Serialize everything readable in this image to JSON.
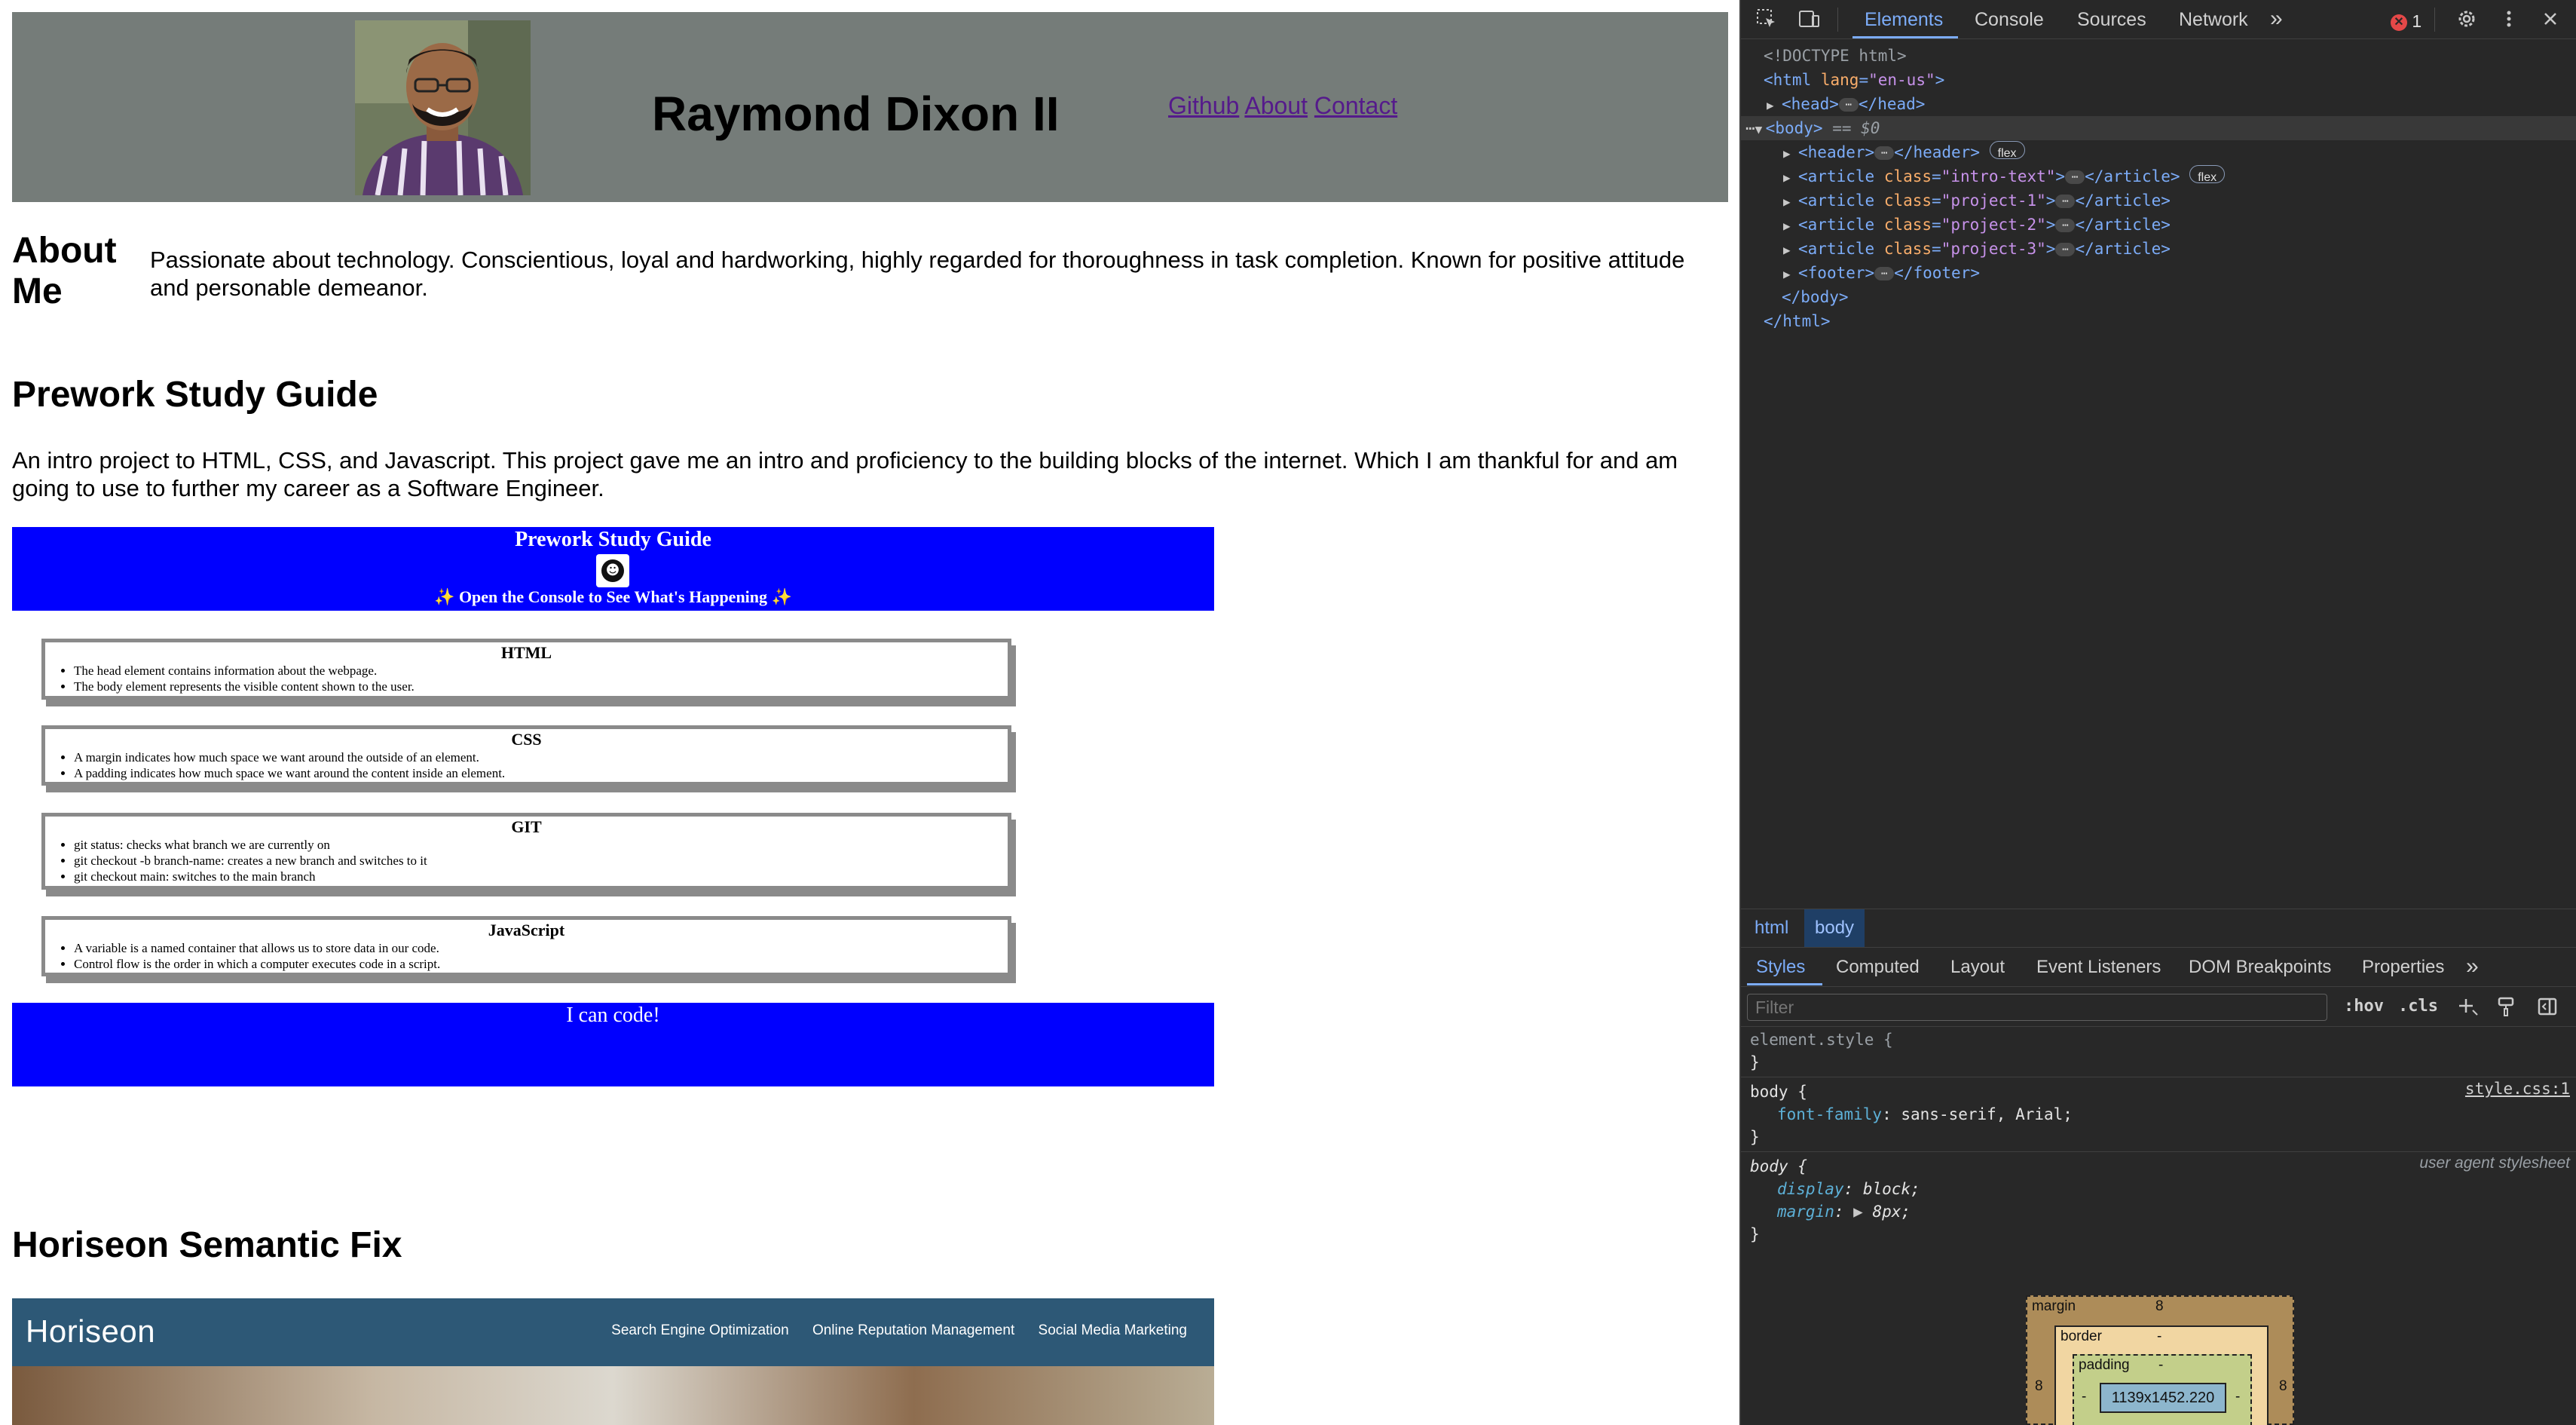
{
  "site": {
    "name": "Raymond Dixon II",
    "nav": [
      "Github",
      "About",
      "Contact"
    ],
    "about_title": "About Me",
    "about_text": "Passionate about technology. Conscientious, loyal and hardworking, highly regarded for thoroughness in task completion. Known for positive attitude and personable demeanor.",
    "projects": [
      {
        "title": "Prework Study Guide",
        "description": "An intro project to HTML, CSS, and Javascript. This project gave me an intro and proficiency to the building blocks of the internet. Which I am thankful for and am going to use to further my career as a Software Engineer."
      },
      {
        "title": "Horiseon Semantic Fix"
      }
    ]
  },
  "prework": {
    "title": "Prework Study Guide",
    "subtitle": "✨ Open the Console to See What's Happening ✨",
    "cards": [
      {
        "title": "HTML",
        "items": [
          "The head element contains information about the webpage.",
          "The body element represents the visible content shown to the user."
        ]
      },
      {
        "title": "CSS",
        "items": [
          "A margin indicates how much space we want around the outside of an element.",
          "A padding indicates how much space we want around the content inside an element."
        ]
      },
      {
        "title": "GIT",
        "items": [
          "git status: checks what branch we are currently on",
          "git checkout -b branch-name: creates a new branch and switches to it",
          "git checkout main: switches to the main branch"
        ]
      },
      {
        "title": "JavaScript",
        "items": [
          "A variable is a named container that allows us to store data in our code.",
          "Control flow is the order in which a computer executes code in a script."
        ]
      }
    ],
    "footer": "I can code!"
  },
  "horiseon": {
    "logo": "Horiseon",
    "nav": [
      "Search Engine Optimization",
      "Online Reputation Management",
      "Social Media Marketing"
    ]
  },
  "devtools": {
    "tabs": [
      "Elements",
      "Console",
      "Sources",
      "Network"
    ],
    "more_tabs": "»",
    "error_count": "1",
    "dom": {
      "doctype": "<!DOCTYPE html>",
      "html_open": "<html",
      "lang_attr": "lang",
      "lang_val": "\"en-us\"",
      "head": "head",
      "body": "body",
      "body_marker": "== $0",
      "children": [
        {
          "tag": "header",
          "cls": "",
          "badge": "flex"
        },
        {
          "tag": "article",
          "cls": "\"intro-text\"",
          "badge": "flex"
        },
        {
          "tag": "article",
          "cls": "\"project-1\"",
          "badge": ""
        },
        {
          "tag": "article",
          "cls": "\"project-2\"",
          "badge": ""
        },
        {
          "tag": "article",
          "cls": "\"project-3\"",
          "badge": ""
        },
        {
          "tag": "footer",
          "cls": "",
          "badge": ""
        }
      ],
      "body_close": "</body>",
      "html_close": "</html>"
    },
    "breadcrumbs": [
      "html",
      "body"
    ],
    "style_tabs": [
      "Styles",
      "Computed",
      "Layout",
      "Event Listeners",
      "DOM Breakpoints",
      "Properties"
    ],
    "filter_placeholder": "Filter",
    "hov": ":hov",
    "cls": ".cls",
    "rules": {
      "element_style": "element.style {",
      "body_rule_selector": "body {",
      "body_rule_source": "style.css:1",
      "body_rule_prop": "font-family",
      "body_rule_val": "sans-serif, Arial;",
      "ua_selector": "body {",
      "ua_source": "user agent stylesheet",
      "ua_prop1": "display",
      "ua_val1": "block;",
      "ua_prop2": "margin",
      "ua_val2": "8px;",
      "close": "}"
    },
    "box_model": {
      "margin_label": "margin",
      "margin_val": "8",
      "border_label": "border",
      "border_val": "-",
      "padding_label": "padding",
      "padding_val": "-",
      "content": "1139x1452.220",
      "side_left": "8",
      "side_right": "8",
      "dash": "-"
    }
  }
}
